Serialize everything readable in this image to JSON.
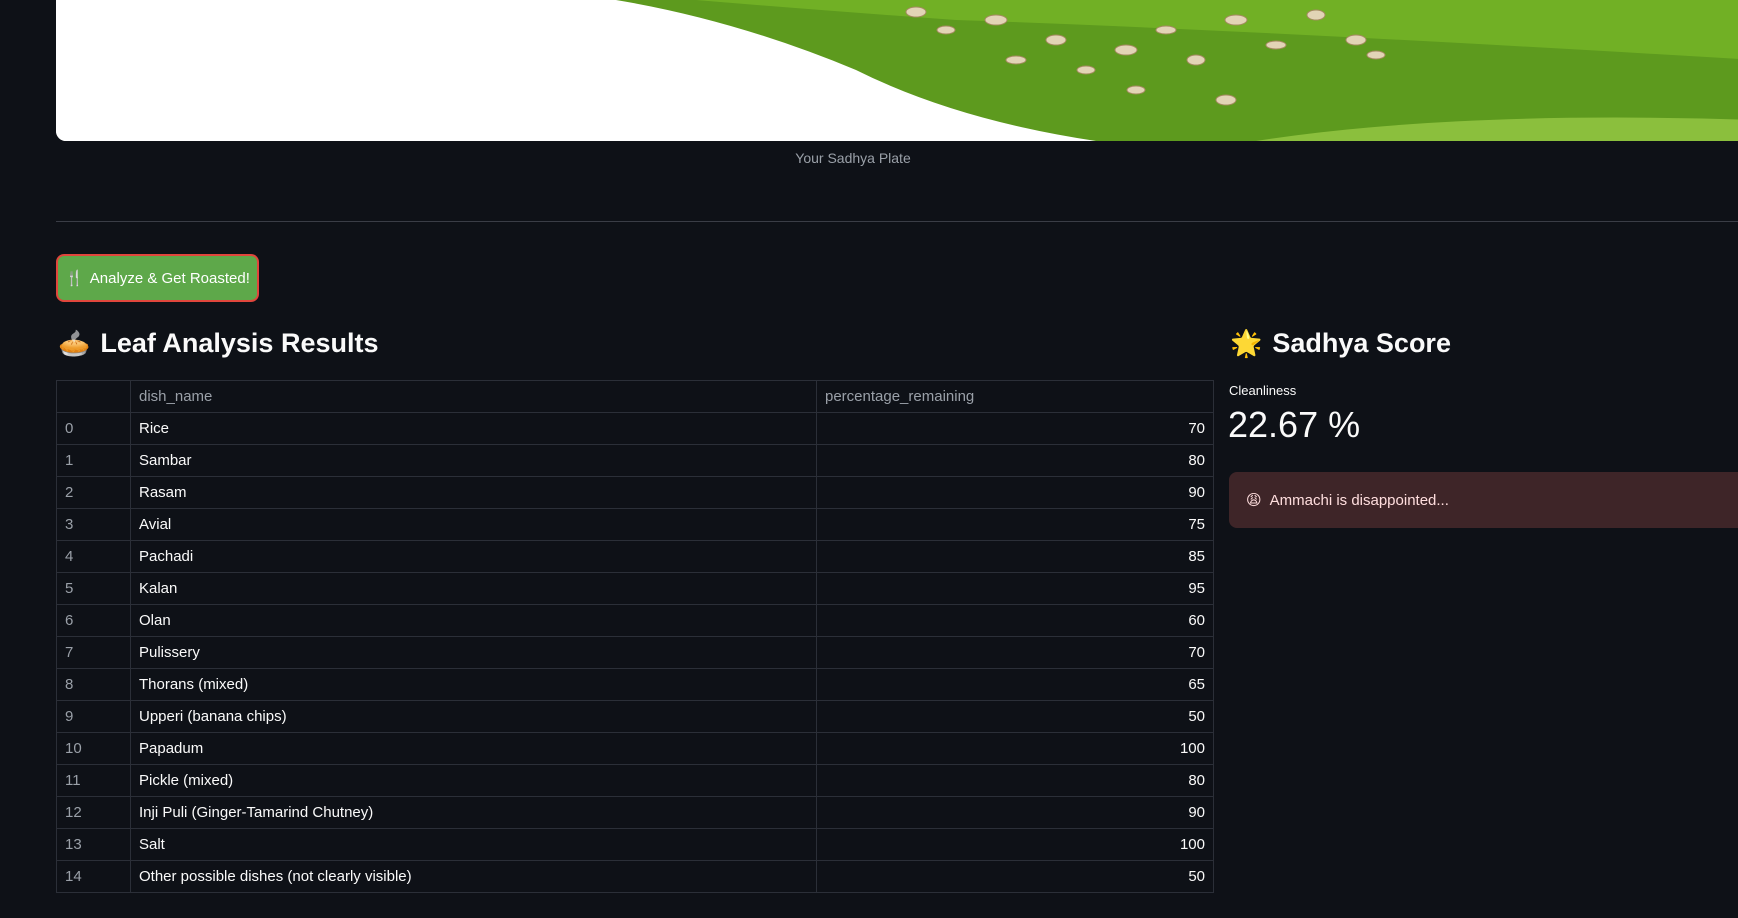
{
  "image": {
    "caption": "Your Sadhya Plate"
  },
  "action": {
    "analyze_label": "Analyze & Get Roasted!",
    "icon": "fork-knife-icon"
  },
  "left": {
    "heading": "Leaf Analysis Results",
    "heading_icon": "leaf-plate-emoji",
    "table": {
      "columns": [
        "",
        "dish_name",
        "percentage_remaining"
      ],
      "rows": [
        {
          "index": "0",
          "dish_name": "Rice",
          "percentage_remaining": "70"
        },
        {
          "index": "1",
          "dish_name": "Sambar",
          "percentage_remaining": "80"
        },
        {
          "index": "2",
          "dish_name": "Rasam",
          "percentage_remaining": "90"
        },
        {
          "index": "3",
          "dish_name": "Avial",
          "percentage_remaining": "75"
        },
        {
          "index": "4",
          "dish_name": "Pachadi",
          "percentage_remaining": "85"
        },
        {
          "index": "5",
          "dish_name": "Kalan",
          "percentage_remaining": "95"
        },
        {
          "index": "6",
          "dish_name": "Olan",
          "percentage_remaining": "60"
        },
        {
          "index": "7",
          "dish_name": "Pulissery",
          "percentage_remaining": "70"
        },
        {
          "index": "8",
          "dish_name": "Thorans (mixed)",
          "percentage_remaining": "65"
        },
        {
          "index": "9",
          "dish_name": "Upperi (banana chips)",
          "percentage_remaining": "50"
        },
        {
          "index": "10",
          "dish_name": "Papadum",
          "percentage_remaining": "100"
        },
        {
          "index": "11",
          "dish_name": "Pickle (mixed)",
          "percentage_remaining": "80"
        },
        {
          "index": "12",
          "dish_name": "Inji Puli (Ginger-Tamarind Chutney)",
          "percentage_remaining": "90"
        },
        {
          "index": "13",
          "dish_name": "Salt",
          "percentage_remaining": "100"
        },
        {
          "index": "14",
          "dish_name": "Other possible dishes (not clearly visible)",
          "percentage_remaining": "50"
        }
      ]
    }
  },
  "right": {
    "heading": "Sadhya Score",
    "heading_icon": "glowing-star-emoji",
    "metric": {
      "label": "Cleanliness",
      "value": "22.67 %"
    },
    "alert": {
      "text": "Ammachi is disappointed...",
      "icon": "weary-face-emoji"
    }
  },
  "colors": {
    "background": "#0e1117",
    "button": "#5ea84a",
    "button_border": "#e0463c",
    "alert_bg": "#3e2528"
  }
}
